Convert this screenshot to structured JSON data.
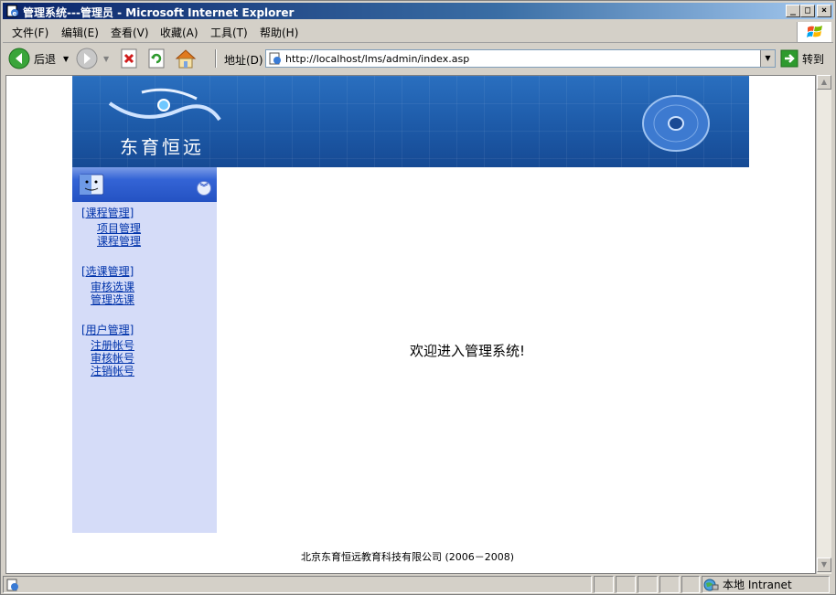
{
  "window": {
    "title": "管理系统---管理员 - Microsoft Internet Explorer",
    "min_glyph": "_",
    "max_glyph": "□",
    "close_glyph": "×"
  },
  "menu": {
    "items": [
      "文件(F)",
      "编辑(E)",
      "查看(V)",
      "收藏(A)",
      "工具(T)",
      "帮助(H)"
    ]
  },
  "toolbar": {
    "back_label": "后退",
    "address_label": "地址(D)",
    "address_value": "http://localhost/lms/admin/index.asp",
    "go_label": "转到"
  },
  "banner": {
    "logo_text": "东育恒远"
  },
  "sidebar": {
    "groups": [
      {
        "label": "[课程管理]",
        "links": [
          "项目管理",
          "课程管理"
        ]
      },
      {
        "label": "[选课管理]",
        "links": [
          "审核选课",
          "管理选课"
        ]
      },
      {
        "label": "[用户管理]",
        "links": [
          "注册帐号",
          "审核帐号",
          "注销帐号"
        ]
      }
    ]
  },
  "main": {
    "welcome": "欢迎进入管理系统!"
  },
  "footer": {
    "text": "北京东育恒远教育科技有限公司 (2006－2008)"
  },
  "status": {
    "zone": "本地 Intranet"
  },
  "colors": {
    "title_bar": "#0a246a",
    "banner": "#1d5aa8",
    "sidebar_bg": "#d5dcf8",
    "link": "#0033aa"
  }
}
